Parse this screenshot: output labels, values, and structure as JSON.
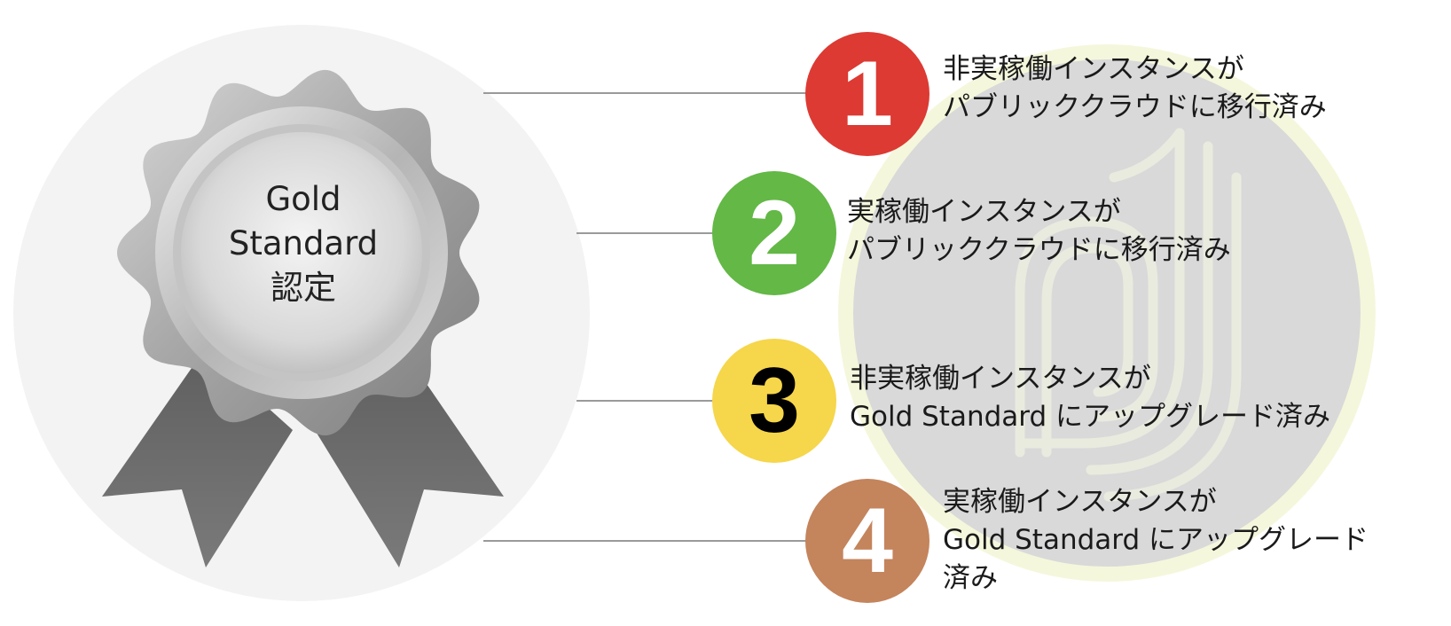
{
  "medal": {
    "line1": "Gold",
    "line2": "Standard",
    "line3": "認定"
  },
  "items": [
    {
      "number": "1",
      "color": "#dc3a33",
      "number_color": "#ffffff",
      "lines": [
        "非実稼働インスタンスが",
        "パブリッククラウドに移行済み"
      ]
    },
    {
      "number": "2",
      "color": "#63b846",
      "number_color": "#ffffff",
      "lines": [
        "実稼働インスタンスが",
        "パブリッククラウドに移行済み"
      ]
    },
    {
      "number": "3",
      "color": "#f6d64a",
      "number_color": "#000000",
      "lines": [
        "非実稼働インスタンスが",
        "Gold Standard にアップグレード済み"
      ]
    },
    {
      "number": "4",
      "color": "#c4845c",
      "number_color": "#ffffff",
      "lines": [
        "実稼働インスタンスが",
        "Gold Standard にアップグレード",
        "済み"
      ]
    }
  ],
  "colors": {
    "left_circle": "#f3f3f3",
    "watermark_circle": "#d9d9d9",
    "watermark_ring": "#f5f7dc",
    "connector": "#9a9a9a",
    "medal_silver": "#b8b8b8",
    "ribbon": "#6e6e6e"
  },
  "icons": {
    "medal": "award-medal-icon",
    "watermark": "brand-logo-watermark"
  }
}
